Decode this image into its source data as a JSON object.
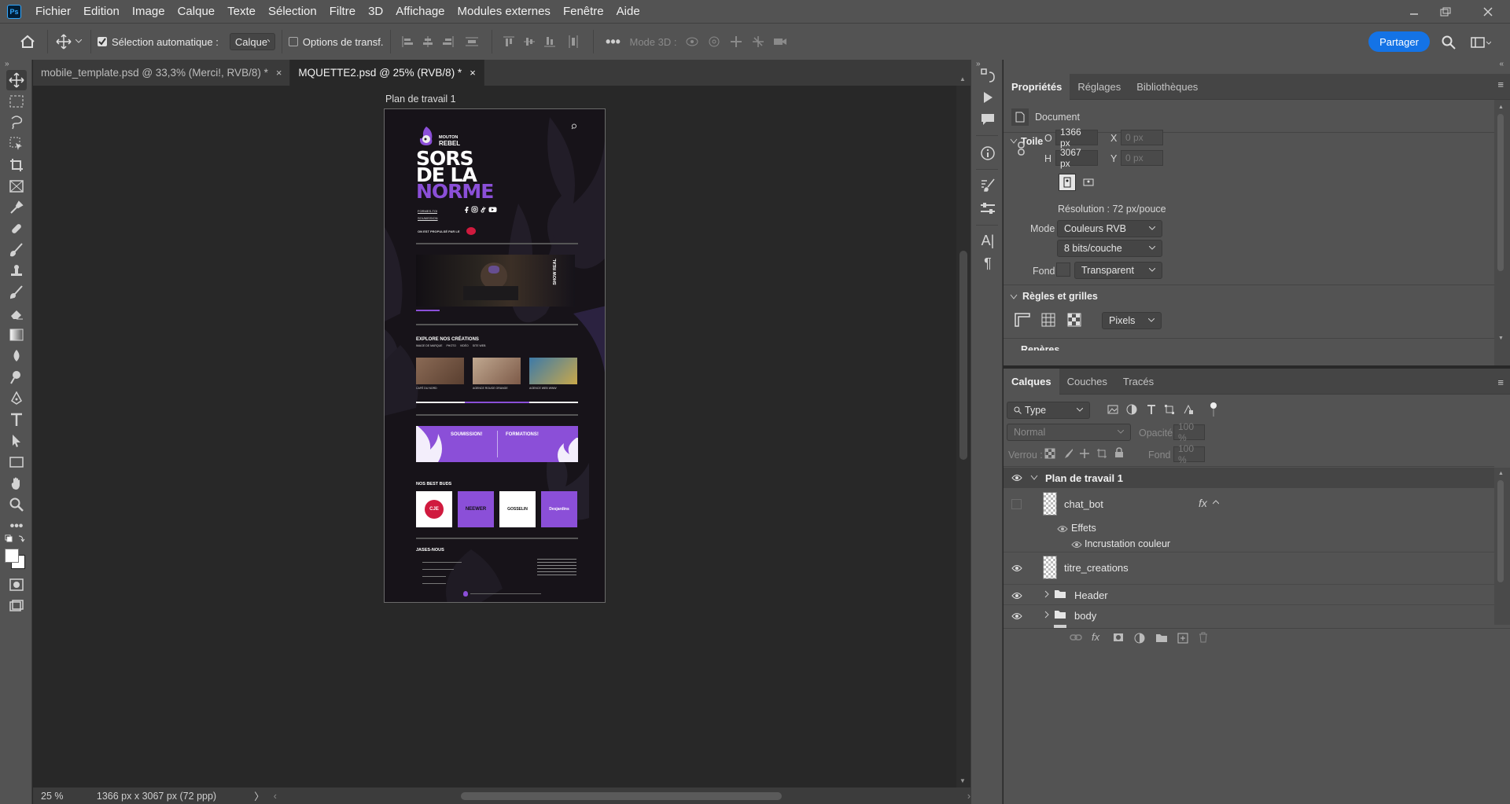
{
  "app": {
    "logo": "Ps",
    "accent": "#31a8ff"
  },
  "menu": [
    "Fichier",
    "Edition",
    "Image",
    "Calque",
    "Texte",
    "Sélection",
    "Filtre",
    "3D",
    "Affichage",
    "Modules externes",
    "Fenêtre",
    "Aide"
  ],
  "options": {
    "auto_select_label": "Sélection automatique :",
    "auto_select_checked": true,
    "auto_select_target": "Calque",
    "transform_label": "Options de transf.",
    "mode3d_label": "Mode 3D :",
    "share_label": "Partager"
  },
  "tabs": [
    {
      "label": "mobile_template.psd @ 33,3% (Merci!, RVB/8) *",
      "close": "×"
    },
    {
      "label": "MQUETTE2.psd @ 25% (RVB/8) *",
      "close": "×"
    }
  ],
  "canvas": {
    "artboard_name": "Plan de travail 1",
    "mockup": {
      "brand_line1": "MOUTON",
      "brand_line2": "REBEL",
      "hero": [
        "SORS",
        "DE LA",
        "NORME"
      ],
      "link1": "FORMES-TOI",
      "link2": "SOUMISSION",
      "powered": "ON EST PROPULSÉ PAR LE",
      "video_label": "SHOW REAL",
      "explore_title": "EXPLORE NOS CRÉATIONS",
      "explore_tabs": [
        "IMAGE DE MARQUE",
        "PHOTO",
        "VIDÉO",
        "SITE WEB"
      ],
      "cards": [
        "CAFÉ DU NORD",
        "AGENCE ROUGE ORANGE",
        "AGENCE WEB WWW"
      ],
      "cta_left": "SOUMISSION!",
      "cta_right": "FORMATIONS!",
      "buds_title": "NOS BEST BUDS",
      "buds": [
        "CJE",
        "NEEWER",
        "GOSSELIN",
        "Desjardins"
      ],
      "contact_title": "JASES-NOUS",
      "purple": "#8b4fd8"
    }
  },
  "status": {
    "zoom": "25 %",
    "doc_size": "1366 px x 3067 px (72 ppp)",
    "arrow": "〉"
  },
  "properties": {
    "tabs": [
      "Propriétés",
      "Réglages",
      "Bibliothèques"
    ],
    "doc_label": "Document",
    "section_toile": "Toile",
    "w_label": "O",
    "w_value": "1366 px",
    "h_label": "H",
    "h_value": "3067 px",
    "x_label": "X",
    "x_value": "0 px",
    "y_label": "Y",
    "y_value": "0 px",
    "resolution": "Résolution : 72 px/pouce",
    "mode_label": "Mode",
    "mode_value": "Couleurs RVB",
    "depth_value": "8 bits/couche",
    "fond_label": "Fond",
    "fond_value": "Transparent",
    "section_regles": "Règles et grilles",
    "units_value": "Pixels",
    "cut_section": "Repères"
  },
  "layers": {
    "tabs": [
      "Calques",
      "Couches",
      "Tracés"
    ],
    "filter_value": "Type",
    "blend_value": "Normal",
    "opacity_label": "Opacité :",
    "opacity_value": "100 %",
    "lock_label": "Verrou :",
    "fill_label": "Fond :",
    "fill_value": "100 %",
    "artboard": "Plan de travail 1",
    "chat_bot": "chat_bot",
    "fx": "fx",
    "effects": "Effets",
    "color_overlay": "Incrustation couleur",
    "titre": "titre_creations",
    "group_header": "Header",
    "group_body": "body"
  }
}
